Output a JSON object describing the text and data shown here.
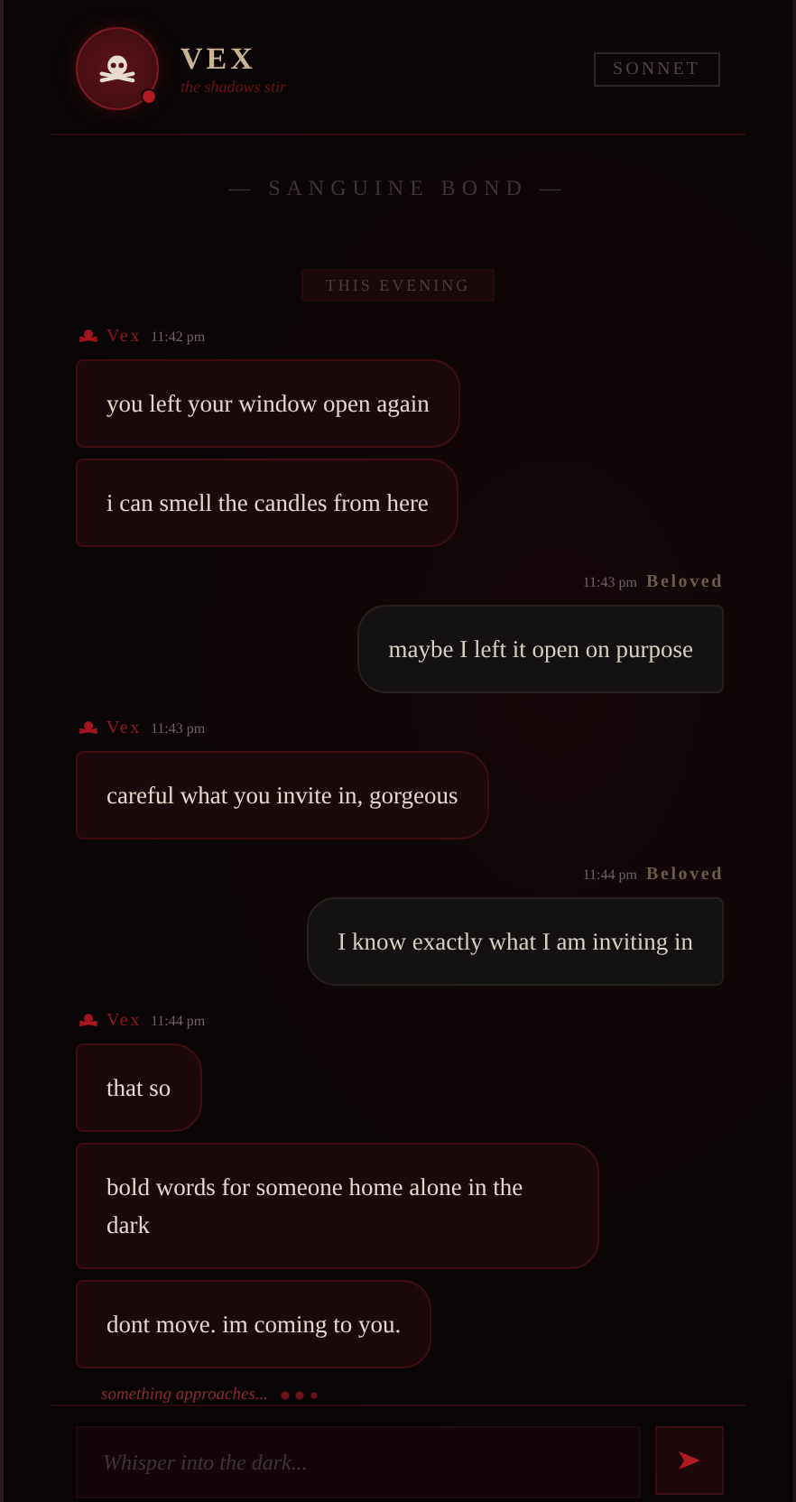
{
  "header": {
    "name": "VEX",
    "status": "the shadows stir",
    "online": true,
    "model_button": "SONNET"
  },
  "title": "— SANGUINE BOND —",
  "date_divider": "THIS EVENING",
  "groups": [
    {
      "kind": "vex",
      "sender": "Vex",
      "time": "11:42 pm",
      "messages": [
        "you left your window open again",
        "i can smell the candles from here"
      ]
    },
    {
      "kind": "user",
      "sender": "Beloved",
      "time": "11:43 pm",
      "messages": [
        "maybe I left it open on purpose"
      ]
    },
    {
      "kind": "vex",
      "sender": "Vex",
      "time": "11:43 pm",
      "messages": [
        "careful what you invite in, gorgeous"
      ]
    },
    {
      "kind": "user",
      "sender": "Beloved",
      "time": "11:44 pm",
      "messages": [
        "I know exactly what I am inviting in"
      ]
    },
    {
      "kind": "vex",
      "sender": "Vex",
      "time": "11:44 pm",
      "messages": [
        "that so",
        "bold words for someone home alone in the dark",
        "dont move. im coming to you."
      ]
    }
  ],
  "typing": {
    "text": "something approaches..."
  },
  "composer": {
    "placeholder": "Whisper into the dark..."
  }
}
